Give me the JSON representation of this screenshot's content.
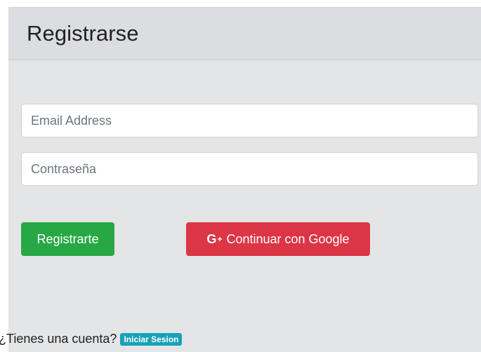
{
  "card": {
    "title": "Registrarse"
  },
  "form": {
    "email_placeholder": "Email Address",
    "password_placeholder": "Contraseña"
  },
  "buttons": {
    "register_label": "Registrarte",
    "google_icon_text": "G",
    "google_icon_plus": "+",
    "google_label": "Continuar con Google"
  },
  "footer": {
    "prompt": "¿Tienes una cuenta?",
    "login_label": "Iniciar Sesion"
  },
  "colors": {
    "register": "#28a745",
    "google": "#dc3545",
    "login_badge": "#17a2b8"
  },
  "icons": {
    "google": "google-plus-icon"
  }
}
